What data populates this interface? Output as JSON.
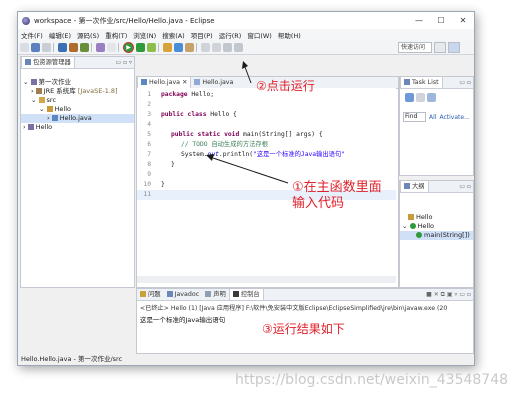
{
  "window": {
    "title": "workspace - 第一次作业/src/Hello/Hello.java - Eclipse",
    "minimize": "—",
    "maximize": "☐",
    "close": "✕"
  },
  "menubar": [
    "文件(F)",
    "编辑(E)",
    "源码(S)",
    "重构(T)",
    "浏览(N)",
    "搜索(A)",
    "项目(P)",
    "运行(R)",
    "窗口(W)",
    "帮助(H)"
  ],
  "toolbar": {
    "quick_access": "快速访问"
  },
  "explorer": {
    "tab": "包资源管理器",
    "tree": [
      {
        "label": "第一次作业",
        "indent": 0,
        "arrow": "⌄"
      },
      {
        "label": "JRE 系统库",
        "suffix": "[JavaSE-1.8]",
        "indent": 1,
        "arrow": "›"
      },
      {
        "label": "src",
        "indent": 1,
        "arrow": "⌄"
      },
      {
        "label": "Hello",
        "indent": 2,
        "arrow": "⌄"
      },
      {
        "label": "Hello.java",
        "indent": 3,
        "arrow": "›"
      },
      {
        "label": "Hello",
        "indent": 0,
        "arrow": "›"
      }
    ]
  },
  "editor": {
    "tabs": [
      "Hello.java",
      "Hello.java"
    ],
    "lines": [
      "1",
      "2",
      "3",
      "4",
      "5",
      "6",
      "7",
      "8",
      "9",
      "10",
      "11"
    ],
    "code": {
      "l1_kw": "package",
      "l1_rest": " Hello;",
      "l3_kw": "public class",
      "l3_rest": " Hello {",
      "l5_kw": "public static void",
      "l5_rest": " main(String[] args) {",
      "l6_comment": "// TODO 自动生成的方法存根",
      "l7_a": "System.",
      "l7_field": "out",
      "l7_b": ".println(",
      "l7_str": "\"这是一个标准的Java输出语句\"",
      "l8": "}",
      "l10": "}"
    }
  },
  "tasklist": {
    "tab": "Task List",
    "find_placeholder": "Find",
    "all": "All",
    "activate": "Activate..."
  },
  "outline": {
    "tab": "大纲",
    "items": [
      "Hello",
      "Hello",
      "main(String[])"
    ]
  },
  "bottom": {
    "tabs": [
      "问题",
      "Javadoc",
      "声明",
      "控制台"
    ],
    "console_header": "<已终止> Hello (1) [Java 应用程序] F:\\软件\\免安装中文版Eclipse\\EclipseSimplified\\jre\\bin\\javaw.exe (20",
    "console_output": "这是一个标准的Java输出语句"
  },
  "statusbar": "Hello.Hello.java - 第一次作业/src",
  "annotations": {
    "step2": "②点击运行",
    "step1_a": "①在主函数里面",
    "step1_b": "输入代码",
    "step3": "③运行结果如下"
  },
  "watermark": "https://blog.csdn.net/weixin_43548748",
  "colors": {
    "annotation": "#e0202a",
    "keyword": "#7f0055",
    "comment": "#3f7f5f",
    "string": "#2a00ff"
  }
}
